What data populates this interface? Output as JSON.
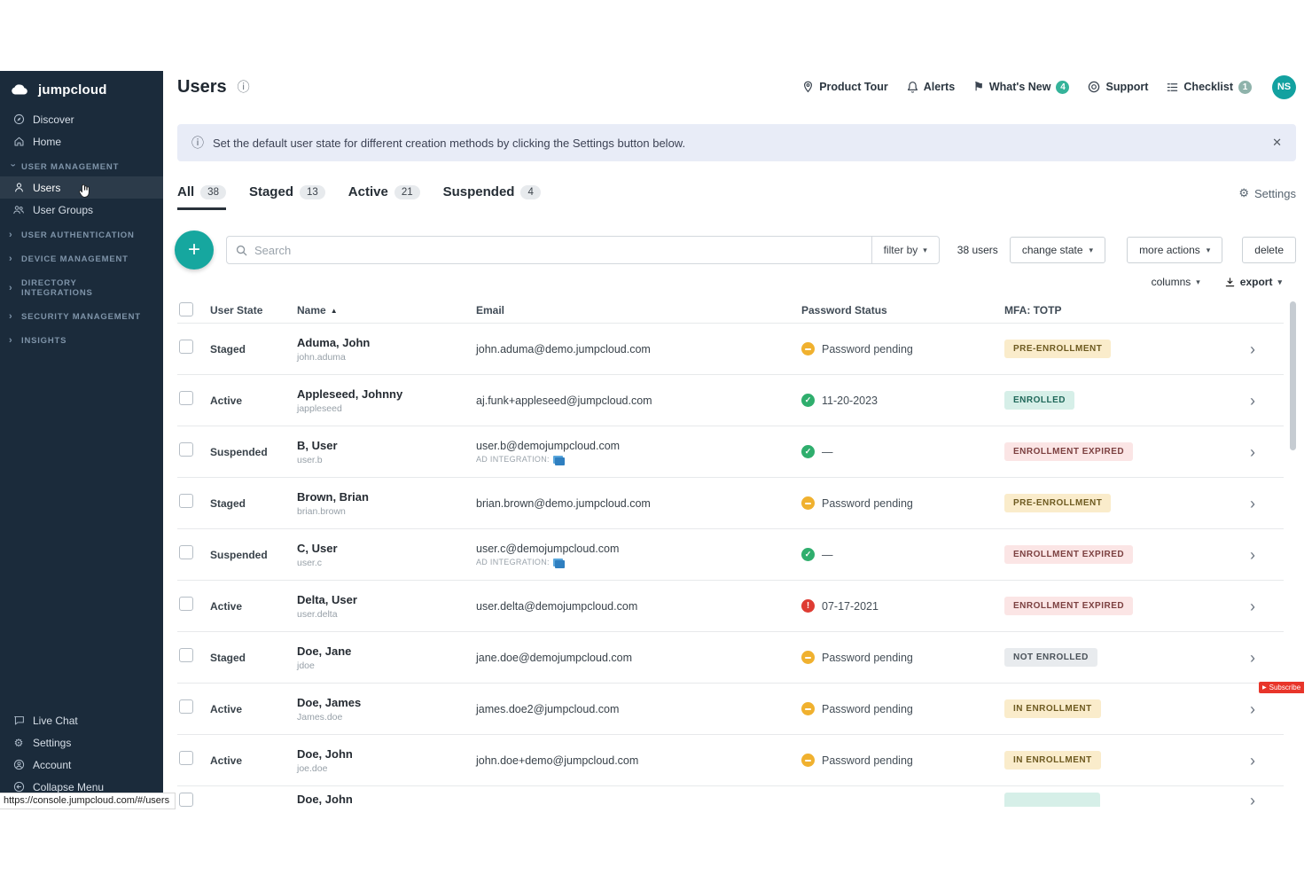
{
  "icons": {
    "caret_down": "▾",
    "sort_asc": "▲",
    "chevron_right": "›",
    "info": "ⓘ",
    "close": "✕",
    "plus": "+",
    "gear": "⚙",
    "flag": "⚑",
    "play": "▶"
  },
  "sidebar": {
    "logo": "jumpcloud",
    "top_items": [
      {
        "label": "Discover"
      },
      {
        "label": "Home"
      }
    ],
    "sections": [
      "USER MANAGEMENT",
      "USER AUTHENTICATION",
      "DEVICE MANAGEMENT",
      "DIRECTORY INTEGRATIONS",
      "SECURITY MANAGEMENT",
      "INSIGHTS"
    ],
    "users_item": "Users",
    "user_groups_item": "User Groups",
    "bottom_items": [
      "Live Chat",
      "Settings",
      "Account",
      "Collapse Menu"
    ],
    "status_url": "https://console.jumpcloud.com/#/users"
  },
  "header": {
    "title": "Users",
    "product_tour": "Product Tour",
    "alerts": "Alerts",
    "whats_new": "What's New",
    "whats_new_badge": "4",
    "support": "Support",
    "checklist": "Checklist",
    "checklist_badge": "1",
    "avatar": "NS"
  },
  "banner": {
    "message": "Set the default user state for different creation methods by clicking the Settings button below."
  },
  "tabs": {
    "all": {
      "label": "All",
      "count": "38"
    },
    "staged": {
      "label": "Staged",
      "count": "13"
    },
    "active": {
      "label": "Active",
      "count": "21"
    },
    "suspended": {
      "label": "Suspended",
      "count": "4"
    },
    "settings": "Settings"
  },
  "toolbar": {
    "search_placeholder": "Search",
    "filter_by": "filter by",
    "user_count": "38 users",
    "change_state": "change state",
    "more_actions": "more actions",
    "delete": "delete",
    "columns": "columns",
    "export": "export"
  },
  "table": {
    "headers": {
      "user_state": "User State",
      "name": "Name",
      "email": "Email",
      "password_status": "Password Status",
      "mfa": "MFA: TOTP"
    },
    "ad_label": "AD Integration:",
    "rows": [
      {
        "state": "Staged",
        "name": "Aduma, John",
        "username": "john.aduma",
        "email": "john.aduma@demo.jumpcloud.com",
        "pw_text": "Password pending",
        "pw": "pending",
        "mfa": "PRE-ENROLLMENT",
        "mfa_variant": "yellow",
        "ad": false
      },
      {
        "state": "Active",
        "name": "Appleseed, Johnny",
        "username": "jappleseed",
        "email": "aj.funk+appleseed@jumpcloud.com",
        "pw_text": "11-20-2023",
        "pw": "ok",
        "mfa": "ENROLLED",
        "mfa_variant": "teal",
        "ad": false
      },
      {
        "state": "Suspended",
        "name": "B, User",
        "username": "user.b",
        "email": "user.b@demojumpcloud.com",
        "pw_text": "—",
        "pw": "ok",
        "mfa": "ENROLLMENT EXPIRED",
        "mfa_variant": "pink",
        "ad": true
      },
      {
        "state": "Staged",
        "name": "Brown, Brian",
        "username": "brian.brown",
        "email": "brian.brown@demo.jumpcloud.com",
        "pw_text": "Password pending",
        "pw": "pending",
        "mfa": "PRE-ENROLLMENT",
        "mfa_variant": "yellow",
        "ad": false
      },
      {
        "state": "Suspended",
        "name": "C, User",
        "username": "user.c",
        "email": "user.c@demojumpcloud.com",
        "pw_text": "—",
        "pw": "ok",
        "mfa": "ENROLLMENT EXPIRED",
        "mfa_variant": "pink",
        "ad": true
      },
      {
        "state": "Active",
        "name": "Delta, User",
        "username": "user.delta",
        "email": "user.delta@demojumpcloud.com",
        "pw_text": "07-17-2021",
        "pw": "error",
        "mfa": "ENROLLMENT EXPIRED",
        "mfa_variant": "pink",
        "ad": false
      },
      {
        "state": "Staged",
        "name": "Doe, Jane",
        "username": "jdoe",
        "email": "jane.doe@demojumpcloud.com",
        "pw_text": "Password pending",
        "pw": "pending",
        "mfa": "NOT ENROLLED",
        "mfa_variant": "gray",
        "ad": false
      },
      {
        "state": "Active",
        "name": "Doe, James",
        "username": "James.doe",
        "email": "james.doe2@jumpcloud.com",
        "pw_text": "Password pending",
        "pw": "pending",
        "mfa": "IN ENROLLMENT",
        "mfa_variant": "yellow",
        "ad": false
      },
      {
        "state": "Active",
        "name": "Doe, John",
        "username": "joe.doe",
        "email": "john.doe+demo@jumpcloud.com",
        "pw_text": "Password pending",
        "pw": "pending",
        "mfa": "IN ENROLLMENT",
        "mfa_variant": "yellow",
        "ad": false
      },
      {
        "state": "",
        "name": "Doe, John",
        "username": "",
        "email": "",
        "pw_text": "",
        "pw": "",
        "mfa": "",
        "mfa_variant": "teal",
        "ad": false
      }
    ]
  },
  "overlay": {
    "subscribe": "Subscribe"
  }
}
